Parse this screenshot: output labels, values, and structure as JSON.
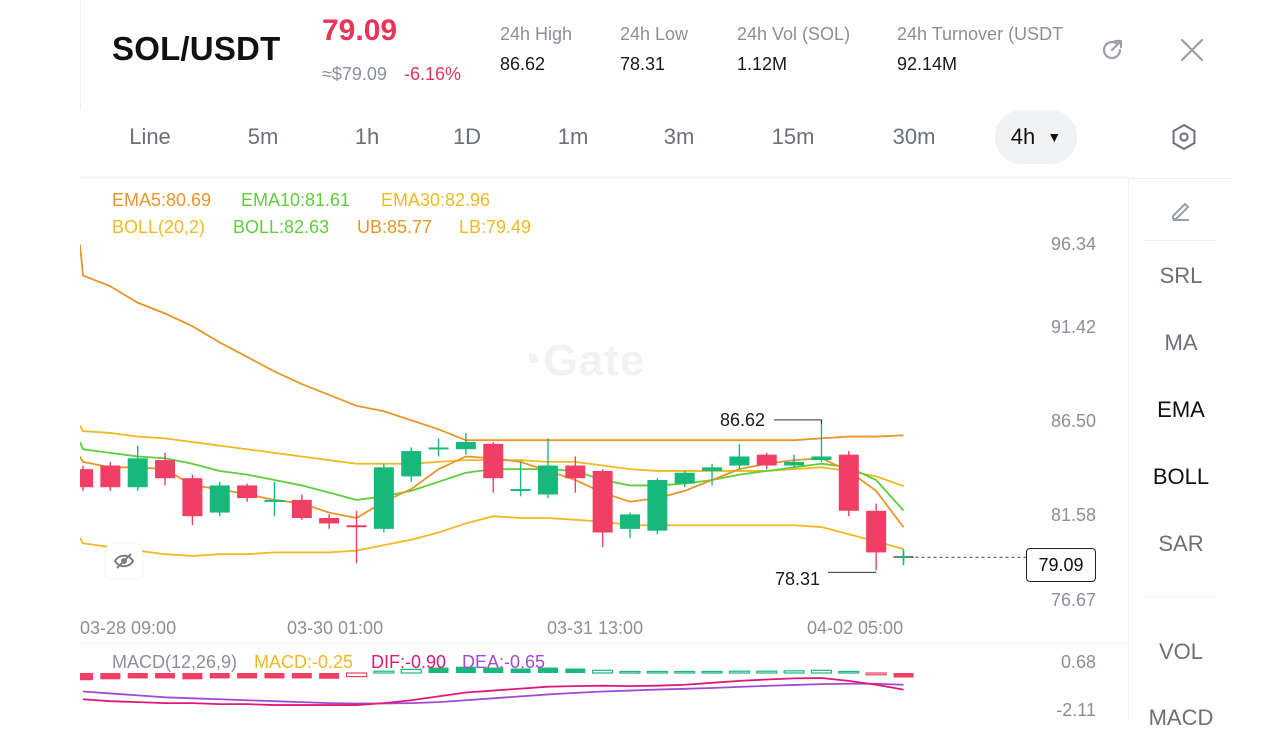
{
  "header": {
    "pair": "SOL/USDT",
    "last_price": "79.09",
    "approx_price": "≈$79.09",
    "change_pct": "-6.16%",
    "stats": [
      {
        "label": "24h   High",
        "value": "86.62"
      },
      {
        "label": "24h   Low",
        "value": "78.31"
      },
      {
        "label": "24h   Vol (SOL)",
        "value": "1.12M"
      },
      {
        "label": "24h   Turnover (USDT",
        "value": "92.14M"
      }
    ],
    "icons": {
      "share": "share-icon",
      "close": "close-icon"
    }
  },
  "tabs": {
    "items": [
      "Line",
      "5m",
      "1h",
      "1D",
      "1m",
      "3m",
      "15m",
      "30m"
    ],
    "active": "4h",
    "settings_icon": "hexagon-settings-icon"
  },
  "legend": {
    "ema5": "EMA5:80.69",
    "ema10": "EMA10:81.61",
    "ema30": "EMA30:82.96",
    "boll": "BOLL(20,2)",
    "boll_mid": "BOLL:82.63",
    "ub": "UB:85.77",
    "lb": "LB:79.49"
  },
  "macd_legend": {
    "name": "MACD(12,26,9)",
    "macd": "MACD:-0.25",
    "dif": "DIF:-0.90",
    "dea": "DEA:-0.65"
  },
  "watermark": "Gate",
  "y_axis": [
    "96.34",
    "91.42",
    "86.50",
    "81.58",
    "76.67"
  ],
  "macd_axis": [
    "0.68",
    "-2.11"
  ],
  "x_axis": [
    "03-28 09:00",
    "03-30 01:00",
    "03-31 13:00",
    "04-02 05:00"
  ],
  "annotations": {
    "high": "86.62",
    "low": "78.31",
    "last": "79.09"
  },
  "side_tools": {
    "draw_icon": "pencil-icon",
    "items": [
      "SRL",
      "MA",
      "EMA",
      "BOLL",
      "SAR"
    ],
    "items2": [
      "VOL",
      "MACD"
    ]
  },
  "colors": {
    "up": "#17b97b",
    "down": "#f03e64",
    "ema5": "#e8962a",
    "ema10": "#5fce3c",
    "ema30": "#f0b922",
    "dif": "#e0187a",
    "dea": "#a04bd6"
  },
  "chart_data": {
    "type": "candlestick",
    "y_range": [
      76.67,
      96.34
    ],
    "candles": [
      {
        "o": 83.9,
        "h": 84.1,
        "l": 82.7,
        "c": 82.9
      },
      {
        "o": 84.1,
        "h": 84.3,
        "l": 82.7,
        "c": 82.9
      },
      {
        "o": 82.9,
        "h": 85.2,
        "l": 82.7,
        "c": 84.5
      },
      {
        "o": 84.4,
        "h": 84.8,
        "l": 83.0,
        "c": 83.4
      },
      {
        "o": 83.4,
        "h": 83.6,
        "l": 80.8,
        "c": 81.3
      },
      {
        "o": 81.5,
        "h": 83.2,
        "l": 81.3,
        "c": 83.0
      },
      {
        "o": 83.0,
        "h": 83.1,
        "l": 82.1,
        "c": 82.3
      },
      {
        "o": 82.1,
        "h": 83.2,
        "l": 81.3,
        "c": 82.2
      },
      {
        "o": 82.2,
        "h": 82.5,
        "l": 81.1,
        "c": 81.2
      },
      {
        "o": 81.2,
        "h": 81.4,
        "l": 80.6,
        "c": 80.9
      },
      {
        "o": 80.8,
        "h": 81.6,
        "l": 78.7,
        "c": 80.7
      },
      {
        "o": 80.6,
        "h": 84.2,
        "l": 80.4,
        "c": 84.0
      },
      {
        "o": 83.5,
        "h": 85.1,
        "l": 83.2,
        "c": 84.9
      },
      {
        "o": 85.0,
        "h": 85.6,
        "l": 84.6,
        "c": 85.1
      },
      {
        "o": 85.0,
        "h": 85.9,
        "l": 84.7,
        "c": 85.4
      },
      {
        "o": 85.3,
        "h": 85.4,
        "l": 82.6,
        "c": 83.4
      },
      {
        "o": 82.7,
        "h": 84.3,
        "l": 82.4,
        "c": 82.8
      },
      {
        "o": 82.5,
        "h": 85.6,
        "l": 82.3,
        "c": 84.1
      },
      {
        "o": 84.1,
        "h": 84.6,
        "l": 82.6,
        "c": 83.4
      },
      {
        "o": 83.8,
        "h": 83.9,
        "l": 79.6,
        "c": 80.4
      },
      {
        "o": 80.6,
        "h": 81.5,
        "l": 80.1,
        "c": 81.4
      },
      {
        "o": 80.5,
        "h": 83.4,
        "l": 80.3,
        "c": 83.3
      },
      {
        "o": 83.1,
        "h": 83.8,
        "l": 82.9,
        "c": 83.7
      },
      {
        "o": 83.8,
        "h": 84.2,
        "l": 83.0,
        "c": 84.0
      },
      {
        "o": 84.1,
        "h": 85.3,
        "l": 83.9,
        "c": 84.6
      },
      {
        "o": 84.7,
        "h": 84.8,
        "l": 83.9,
        "c": 84.1
      },
      {
        "o": 84.1,
        "h": 84.7,
        "l": 84.0,
        "c": 84.3
      },
      {
        "o": 84.4,
        "h": 86.62,
        "l": 84.3,
        "c": 84.6
      },
      {
        "o": 84.7,
        "h": 84.9,
        "l": 81.3,
        "c": 81.6
      },
      {
        "o": 81.6,
        "h": 82.0,
        "l": 78.31,
        "c": 79.3
      },
      {
        "o": 79.1,
        "h": 79.3,
        "l": 78.9,
        "c": 79.09
      }
    ],
    "ema5": [
      84.3,
      84.0,
      84.0,
      83.9,
      83.0,
      82.8,
      82.5,
      82.2,
      82.0,
      81.5,
      81.2,
      82.1,
      82.8,
      83.9,
      84.6,
      84.5,
      84.3,
      83.8,
      83.3,
      82.6,
      82.1,
      82.3,
      82.7,
      83.3,
      83.9,
      84.2,
      84.4,
      84.5,
      83.8,
      82.7,
      80.69
    ],
    "ema10": [
      85.0,
      84.8,
      84.6,
      84.5,
      84.2,
      83.8,
      83.6,
      83.3,
      83.0,
      82.6,
      82.2,
      82.4,
      82.7,
      83.2,
      83.7,
      83.9,
      83.9,
      83.9,
      83.8,
      83.3,
      83.0,
      83.0,
      83.1,
      83.3,
      83.6,
      83.8,
      84.0,
      84.2,
      84.0,
      83.3,
      81.61
    ],
    "ema30": [
      86.0,
      85.9,
      85.7,
      85.6,
      85.4,
      85.2,
      85.0,
      84.8,
      84.6,
      84.4,
      84.2,
      84.2,
      84.2,
      84.3,
      84.4,
      84.4,
      84.4,
      84.3,
      84.3,
      84.1,
      83.9,
      83.8,
      83.8,
      83.8,
      83.8,
      83.8,
      83.9,
      84.0,
      83.8,
      83.5,
      82.96
    ],
    "boll_ub": [
      94.6,
      94.0,
      93.1,
      92.5,
      91.8,
      90.9,
      90.1,
      89.3,
      88.6,
      88.0,
      87.4,
      87.1,
      86.6,
      86.1,
      85.5,
      85.5,
      85.5,
      85.5,
      85.5,
      85.5,
      85.5,
      85.5,
      85.5,
      85.5,
      85.5,
      85.5,
      85.5,
      85.6,
      85.7,
      85.7,
      85.77
    ],
    "boll_lb": [
      79.8,
      79.6,
      79.4,
      79.2,
      79.1,
      79.2,
      79.2,
      79.3,
      79.3,
      79.3,
      79.4,
      79.7,
      80.0,
      80.4,
      80.9,
      81.3,
      81.2,
      81.2,
      81.1,
      81.0,
      80.8,
      80.8,
      80.8,
      80.8,
      80.8,
      80.8,
      80.8,
      80.7,
      80.3,
      79.9,
      79.49
    ],
    "macd_hist": [
      -0.4,
      -0.35,
      -0.3,
      -0.3,
      -0.35,
      -0.3,
      -0.3,
      -0.3,
      -0.3,
      -0.32,
      -0.2,
      0.1,
      0.2,
      0.3,
      0.35,
      0.3,
      0.25,
      0.3,
      0.25,
      0.15,
      0.08,
      0.05,
      0.06,
      0.08,
      0.1,
      0.1,
      0.12,
      0.15,
      0.05,
      -0.1,
      -0.25
    ],
    "dif": [
      -1.4,
      -1.5,
      -1.55,
      -1.6,
      -1.6,
      -1.65,
      -1.65,
      -1.7,
      -1.7,
      -1.7,
      -1.7,
      -1.6,
      -1.45,
      -1.25,
      -1.05,
      -0.95,
      -0.85,
      -0.75,
      -0.72,
      -0.7,
      -0.72,
      -0.7,
      -0.65,
      -0.55,
      -0.45,
      -0.38,
      -0.32,
      -0.3,
      -0.45,
      -0.65,
      -0.9
    ],
    "dea": [
      -1.0,
      -1.1,
      -1.2,
      -1.3,
      -1.35,
      -1.4,
      -1.45,
      -1.5,
      -1.55,
      -1.6,
      -1.62,
      -1.62,
      -1.6,
      -1.55,
      -1.45,
      -1.35,
      -1.25,
      -1.15,
      -1.07,
      -1.0,
      -0.95,
      -0.9,
      -0.86,
      -0.82,
      -0.76,
      -0.71,
      -0.66,
      -0.62,
      -0.6,
      -0.6,
      -0.65
    ],
    "macd_range": [
      -2.11,
      0.68
    ]
  }
}
